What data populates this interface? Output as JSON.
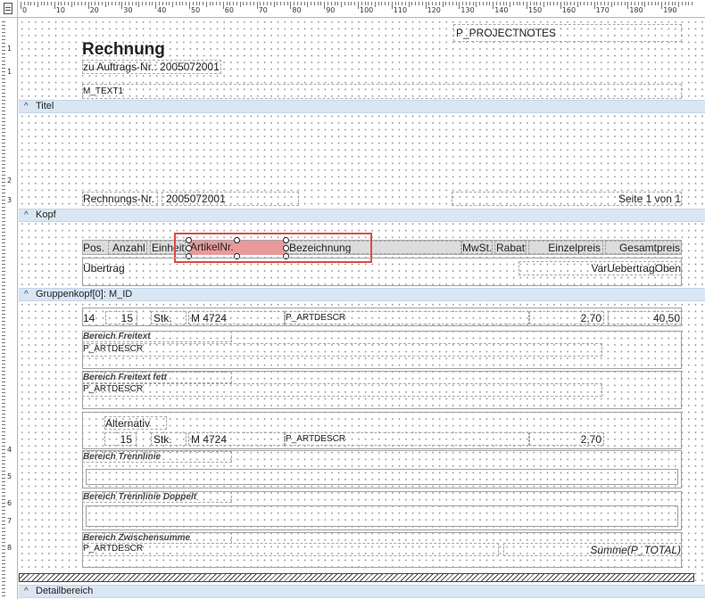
{
  "ruler": {
    "top_labels": [
      "0",
      "10",
      "20",
      "30",
      "40",
      "50",
      "60",
      "70",
      "80",
      "90",
      "100",
      "110",
      "120",
      "130",
      "140",
      "150",
      "160",
      "170",
      "180",
      "190"
    ],
    "left_labels": [
      "1",
      "1",
      "2",
      "3",
      "4",
      "5",
      "6",
      "7",
      "8"
    ]
  },
  "bands": {
    "titel": "Titel",
    "kopf": "Kopf",
    "gruppenkopf": "Gruppenkopf[0]: M_ID",
    "detail": "Detailbereich",
    "chevron": "^"
  },
  "header": {
    "project_notes": "P_PROJECTNOTES",
    "title": "Rechnung",
    "order_label": "zu Auftrags-Nr.: 2005072001",
    "m_text": "M_TEXT1",
    "invoice_no_label": "Rechnungs-Nr.",
    "invoice_no_value": "2005072001",
    "page_info": "Seite 1 von 1"
  },
  "kopf": {
    "columns": [
      "Pos.",
      "Anzahl",
      "Einheit",
      "ArtikelNr.",
      "Bezeichnung",
      "MwSt.",
      "Rabatt",
      "Einzelpreis",
      "Gesamtpreis"
    ],
    "uebertrag_label": "Übertrag",
    "uebertrag_value": "VarUebertragOben"
  },
  "position": {
    "pos": "14",
    "qty": "15",
    "unit": "Stk.",
    "article": "M 4724",
    "descr": "P_ARTDESCR",
    "unit_price": "2,70",
    "total": "40,50"
  },
  "sections": {
    "freitext_title": "Bereich Freitext",
    "freitext_field": "P_ARTDESCR",
    "freitext_fett_title": "Bereich Freitext fett",
    "freitext_fett_field": "P_ARTDESCR",
    "alternativ_label": "Alternativ",
    "alt_qty": "15",
    "alt_unit": "Stk.",
    "alt_article": "M 4724",
    "alt_descr": "P_ARTDESCR",
    "alt_price": "2,70",
    "trennlinie_title": "Bereich Trennlinie",
    "trennlinie_doppelt_title": "Bereich Trennlinie Doppelt",
    "zwischensumme_title": "Bereich Zwischensumme",
    "zwischensumme_field": "P_ARTDESCR",
    "zwischensumme_total": "Summe(P_TOTAL)"
  },
  "colors": {
    "band_bg": "#d9e6f3",
    "selection": "#e04848",
    "selected_fill": "#e89a9a"
  }
}
